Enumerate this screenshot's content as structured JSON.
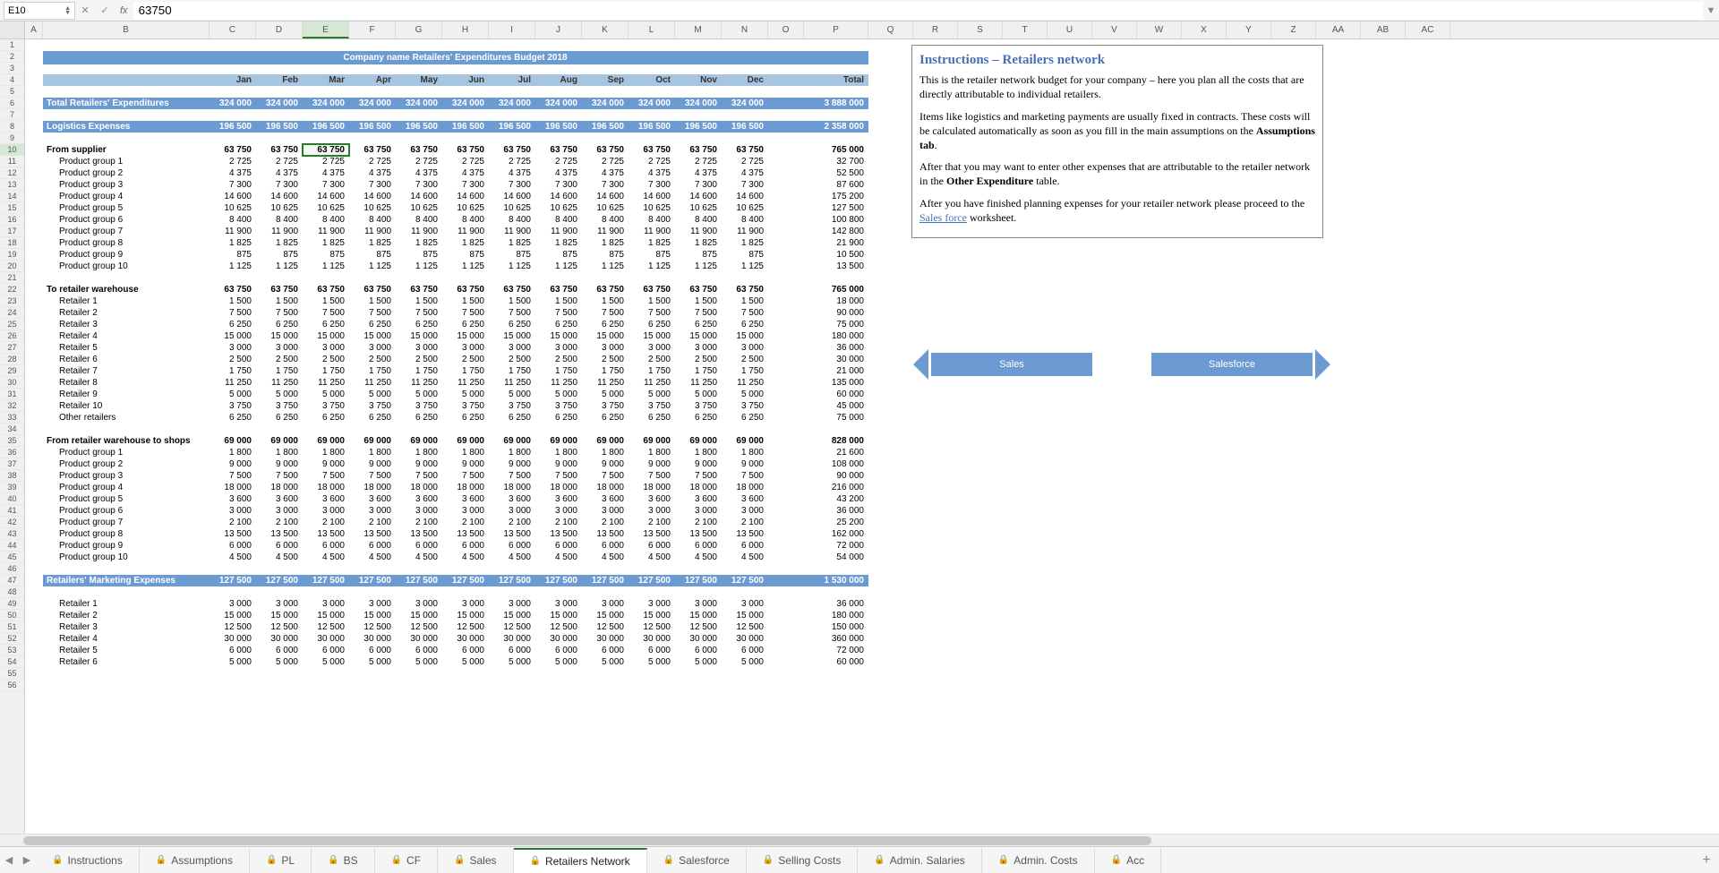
{
  "nameBox": "E10",
  "formula": "63750",
  "columns": [
    "A",
    "B",
    "C",
    "D",
    "E",
    "F",
    "G",
    "H",
    "I",
    "J",
    "K",
    "L",
    "M",
    "N",
    "O",
    "P",
    "Q",
    "R",
    "S",
    "T",
    "U",
    "V",
    "W",
    "X",
    "Y",
    "Z",
    "AA",
    "AB",
    "AC"
  ],
  "colWidths": {
    "A": 20,
    "B": 186,
    "C": 52,
    "D": 52,
    "E": 52,
    "F": 52,
    "G": 52,
    "H": 52,
    "I": 52,
    "J": 52,
    "K": 52,
    "L": 52,
    "M": 52,
    "N": 52,
    "O": 40,
    "P": 72
  },
  "selectedCol": "E",
  "selectedRow": 10,
  "title": "Company name Retailers' Expenditures Budget 2018",
  "months": [
    "Jan",
    "Feb",
    "Mar",
    "Apr",
    "May",
    "Jun",
    "Jul",
    "Aug",
    "Sep",
    "Oct",
    "Nov",
    "Dec",
    "",
    "Total"
  ],
  "rows": [
    {
      "r": 1
    },
    {
      "r": 2,
      "type": "title",
      "text": "Company name Retailers' Expenditures Budget 2018"
    },
    {
      "r": 3
    },
    {
      "r": 4,
      "type": "months"
    },
    {
      "r": 5
    },
    {
      "r": 6,
      "type": "section",
      "label": "Total Retailers' Expenditures",
      "v": "324 000",
      "t": "3 888 000"
    },
    {
      "r": 7
    },
    {
      "r": 8,
      "type": "section",
      "label": "Logistics Expenses",
      "v": "196 500",
      "t": "2 358 000"
    },
    {
      "r": 9
    },
    {
      "r": 10,
      "type": "sub",
      "label": "From supplier",
      "v": "63 750",
      "t": "765 000"
    },
    {
      "r": 11,
      "type": "item",
      "label": "Product group 1",
      "v": "2 725",
      "t": "32 700"
    },
    {
      "r": 12,
      "type": "item",
      "label": "Product group 2",
      "v": "4 375",
      "t": "52 500"
    },
    {
      "r": 13,
      "type": "item",
      "label": "Product group 3",
      "v": "7 300",
      "t": "87 600"
    },
    {
      "r": 14,
      "type": "item",
      "label": "Product group 4",
      "v": "14 600",
      "t": "175 200"
    },
    {
      "r": 15,
      "type": "item",
      "label": "Product group 5",
      "v": "10 625",
      "t": "127 500"
    },
    {
      "r": 16,
      "type": "item",
      "label": "Product group 6",
      "v": "8 400",
      "t": "100 800"
    },
    {
      "r": 17,
      "type": "item",
      "label": "Product group 7",
      "v": "11 900",
      "t": "142 800"
    },
    {
      "r": 18,
      "type": "item",
      "label": "Product group 8",
      "v": "1 825",
      "t": "21 900"
    },
    {
      "r": 19,
      "type": "item",
      "label": "Product group 9",
      "v": "875",
      "t": "10 500"
    },
    {
      "r": 20,
      "type": "item",
      "label": "Product group 10",
      "v": "1 125",
      "t": "13 500"
    },
    {
      "r": 21
    },
    {
      "r": 22,
      "type": "sub",
      "label": "To retailer warehouse",
      "v": "63 750",
      "t": "765 000"
    },
    {
      "r": 23,
      "type": "item",
      "label": "Retailer 1",
      "v": "1 500",
      "t": "18 000"
    },
    {
      "r": 24,
      "type": "item",
      "label": "Retailer 2",
      "v": "7 500",
      "t": "90 000"
    },
    {
      "r": 25,
      "type": "item",
      "label": "Retailer 3",
      "v": "6 250",
      "t": "75 000"
    },
    {
      "r": 26,
      "type": "item",
      "label": "Retailer 4",
      "v": "15 000",
      "t": "180 000"
    },
    {
      "r": 27,
      "type": "item",
      "label": "Retailer 5",
      "v": "3 000",
      "t": "36 000"
    },
    {
      "r": 28,
      "type": "item",
      "label": "Retailer 6",
      "v": "2 500",
      "t": "30 000"
    },
    {
      "r": 29,
      "type": "item",
      "label": "Retailer 7",
      "v": "1 750",
      "t": "21 000"
    },
    {
      "r": 30,
      "type": "item",
      "label": "Retailer 8",
      "v": "11 250",
      "t": "135 000"
    },
    {
      "r": 31,
      "type": "item",
      "label": "Retailer 9",
      "v": "5 000",
      "t": "60 000"
    },
    {
      "r": 32,
      "type": "item",
      "label": "Retailer 10",
      "v": "3 750",
      "t": "45 000"
    },
    {
      "r": 33,
      "type": "item",
      "label": "Other retailers",
      "v": "6 250",
      "t": "75 000"
    },
    {
      "r": 34
    },
    {
      "r": 35,
      "type": "sub",
      "label": "From retailer warehouse to shops",
      "v": "69 000",
      "t": "828 000"
    },
    {
      "r": 36,
      "type": "item",
      "label": "Product group 1",
      "v": "1 800",
      "t": "21 600"
    },
    {
      "r": 37,
      "type": "item",
      "label": "Product group 2",
      "v": "9 000",
      "t": "108 000"
    },
    {
      "r": 38,
      "type": "item",
      "label": "Product group 3",
      "v": "7 500",
      "t": "90 000"
    },
    {
      "r": 39,
      "type": "item",
      "label": "Product group 4",
      "v": "18 000",
      "t": "216 000"
    },
    {
      "r": 40,
      "type": "item",
      "label": "Product group 5",
      "v": "3 600",
      "t": "43 200"
    },
    {
      "r": 41,
      "type": "item",
      "label": "Product group 6",
      "v": "3 000",
      "t": "36 000"
    },
    {
      "r": 42,
      "type": "item",
      "label": "Product group 7",
      "v": "2 100",
      "t": "25 200"
    },
    {
      "r": 43,
      "type": "item",
      "label": "Product group 8",
      "v": "13 500",
      "t": "162 000"
    },
    {
      "r": 44,
      "type": "item",
      "label": "Product group 9",
      "v": "6 000",
      "t": "72 000"
    },
    {
      "r": 45,
      "type": "item",
      "label": "Product group 10",
      "v": "4 500",
      "t": "54 000"
    },
    {
      "r": 46
    },
    {
      "r": 47,
      "type": "section",
      "label": "Retailers' Marketing Expenses",
      "v": "127 500",
      "t": "1 530 000"
    },
    {
      "r": 48
    },
    {
      "r": 49,
      "type": "item",
      "label": "Retailer 1",
      "v": "3 000",
      "t": "36 000"
    },
    {
      "r": 50,
      "type": "item",
      "label": "Retailer 2",
      "v": "15 000",
      "t": "180 000"
    },
    {
      "r": 51,
      "type": "item",
      "label": "Retailer 3",
      "v": "12 500",
      "t": "150 000"
    },
    {
      "r": 52,
      "type": "item",
      "label": "Retailer 4",
      "v": "30 000",
      "t": "360 000"
    },
    {
      "r": 53,
      "type": "item",
      "label": "Retailer 5",
      "v": "6 000",
      "t": "72 000"
    },
    {
      "r": 54,
      "type": "item",
      "label": "Retailer 6",
      "v": "5 000",
      "t": "60 000"
    }
  ],
  "instructions": {
    "heading": "Instructions – Retailers network",
    "p1": "This is the retailer network budget for your company – here you plan all the costs that are directly attributable to individual retailers.",
    "p2a": "Items like logistics and marketing payments are usually fixed in contracts. These costs will be calculated automatically as soon as you fill in the main assumptions on the ",
    "p2b": "Assumptions tab",
    "p2c": ".",
    "p3a": "After that you may want to enter other expenses that are attributable to the retailer network in the ",
    "p3b": "Other Expenditure",
    "p3c": " table.",
    "p4a": "After you have finished planning expenses for your retailer network please proceed to the ",
    "p4b": "Sales force",
    "p4c": " worksheet."
  },
  "navButtons": {
    "left": "Sales",
    "right": "Salesforce"
  },
  "tabs": [
    "Instructions",
    "Assumptions",
    "PL",
    "BS",
    "CF",
    "Sales",
    "Retailers Network",
    "Salesforce",
    "Selling Costs",
    "Admin. Salaries",
    "Admin. Costs",
    "Acc"
  ],
  "activeTab": 6
}
